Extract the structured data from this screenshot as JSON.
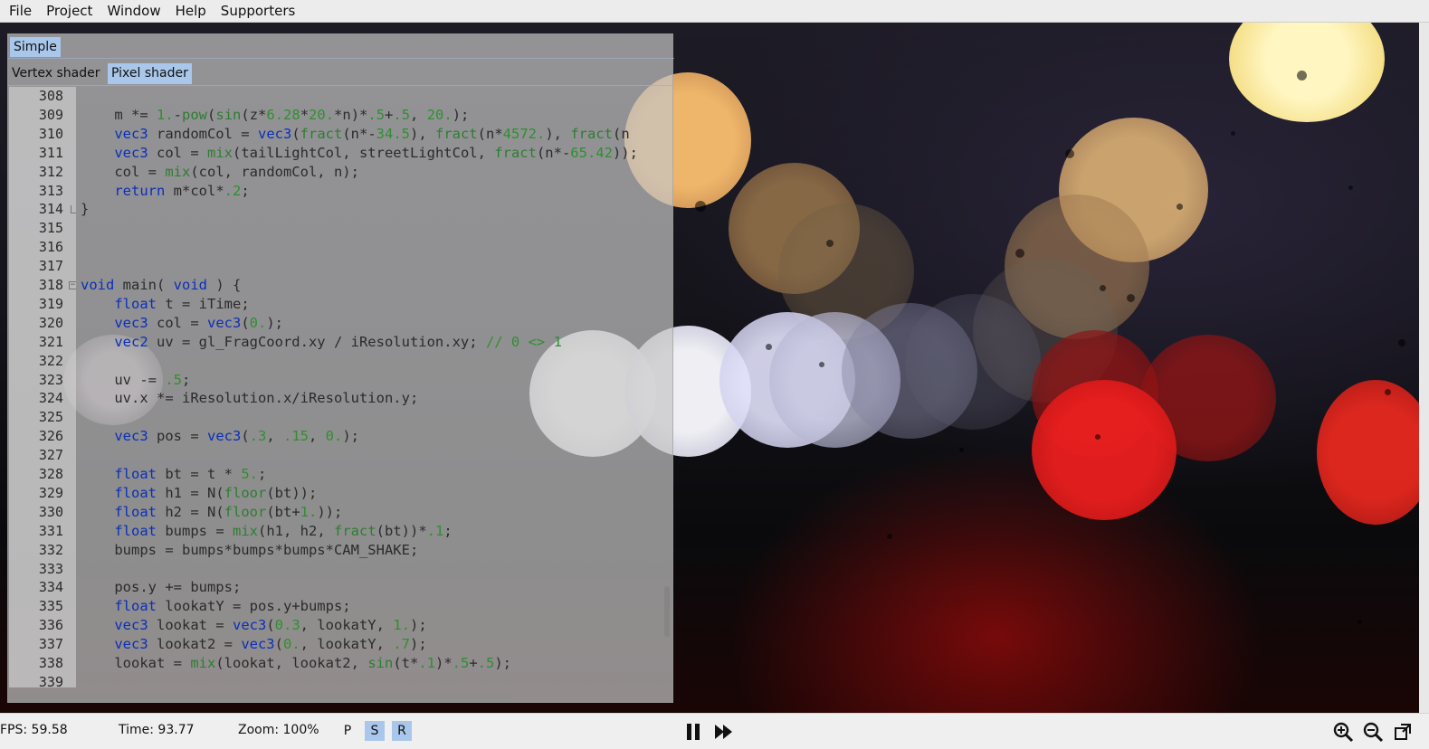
{
  "menu": [
    "File",
    "Project",
    "Window",
    "Help",
    "Supporters"
  ],
  "project_tab": "Simple",
  "shader_tabs": [
    "Vertex shader",
    "Pixel shader"
  ],
  "active_shader_tab": "Pixel shader",
  "editor": {
    "line_numbers": [
      "308",
      "309",
      "310",
      "311",
      "312",
      "313",
      "314",
      "315",
      "316",
      "317",
      "318",
      "319",
      "320",
      "321",
      "322",
      "323",
      "324",
      "325",
      "326",
      "327",
      "328",
      "329",
      "330",
      "331",
      "332",
      "333",
      "334",
      "335",
      "336",
      "337",
      "338",
      "339"
    ],
    "lines": [
      "",
      "    m *= 1.-pow(sin(z*6.28*20.*n)*.5+.5, 20.);",
      "    vec3 randomCol = vec3(fract(n*-34.5), fract(n*4572.), fract(n",
      "    vec3 col = mix(tailLightCol, streetLightCol, fract(n*-65.42));",
      "    col = mix(col, randomCol, n);",
      "    return m*col*.2;",
      "}",
      "",
      "",
      "",
      "void main( void ) {",
      "    float t = iTime;",
      "    vec3 col = vec3(0.);",
      "    vec2 uv = gl_FragCoord.xy / iResolution.xy; // 0 <> 1",
      "",
      "    uv -= .5;",
      "    uv.x *= iResolution.x/iResolution.y;",
      "",
      "    vec3 pos = vec3(.3, .15, 0.);",
      "",
      "    float bt = t * 5.;",
      "    float h1 = N(floor(bt));",
      "    float h2 = N(floor(bt+1.));",
      "    float bumps = mix(h1, h2, fract(bt))*.1;",
      "    bumps = bumps*bumps*bumps*CAM_SHAKE;",
      "",
      "    pos.y += bumps;",
      "    float lookatY = pos.y+bumps;",
      "    vec3 lookat = vec3(0.3, lookatY, 1.);",
      "    vec3 lookat2 = vec3(0., lookatY, .7);",
      "    lookat = mix(lookat, lookat2, sin(t*.1)*.5+.5);",
      ""
    ]
  },
  "status": {
    "fps": "FPS: 59.58",
    "time": "Time: 93.77",
    "zoom": "Zoom: 100%",
    "modes": [
      "P",
      "S",
      "R"
    ],
    "active_modes": [
      "S",
      "R"
    ]
  },
  "icons": [
    "pause-icon",
    "fast-forward-icon",
    "zoom-in-icon",
    "zoom-out-icon",
    "fullscreen-icon"
  ]
}
